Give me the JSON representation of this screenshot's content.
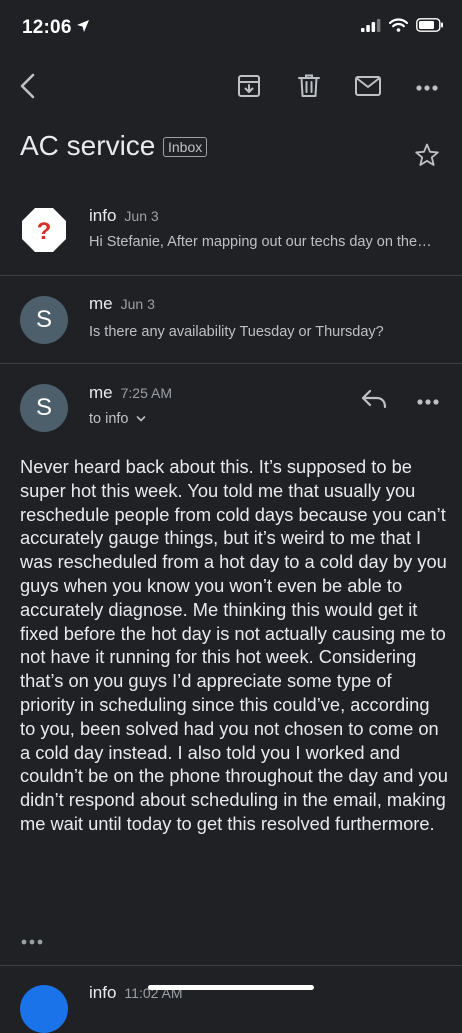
{
  "status_bar": {
    "time": "12:06"
  },
  "icons": [
    "location-arrow-icon",
    "signal-icon",
    "wifi-icon",
    "battery-icon",
    "back-arrow-icon",
    "archive-icon",
    "trash-icon",
    "mail-icon",
    "more-icon",
    "star-icon",
    "reply-icon",
    "warning-question-icon",
    "chevron-down-icon"
  ],
  "email": {
    "subject": "AC service",
    "label": "Inbox"
  },
  "thread": [
    {
      "sender": "info",
      "date": "Jun 3",
      "snippet": "Hi Stefanie, After mapping out our techs day on the route we would like to reschedule"
    },
    {
      "sender": "me",
      "avatar_letter": "S",
      "date": "Jun 3",
      "snippet": "Is there any availability Tuesday or Thursday?"
    },
    {
      "sender": "me",
      "avatar_letter": "S",
      "date": "7:25 AM",
      "to_line": "to info",
      "body": "Never heard back about this. It’s supposed to be super hot this week. You told me that usually you reschedule people from cold days because you can’t accurately gauge things, but it’s weird to me that I was rescheduled from a hot day to a cold day by you guys when you know you won’t even be able to accurately diagnose. Me thinking this would get it fixed before the hot day is not actually causing me to not have it running for this hot week. Considering that’s on you guys I’d appreciate some type of priority in scheduling since this could’ve, according to you, been solved had you not chosen to come on a cold day instead. I also told you I worked and couldn’t be on the phone throughout the day and you didn’t respond about scheduling in the email, making me wait until today to get this resolved furthermore."
    },
    {
      "sender": "info",
      "date": "11:02 AM"
    }
  ],
  "colors": {
    "background": "#202124",
    "avatar": "#4d5f6b",
    "info_avatar": "#1a73e8",
    "warning": "#d93025"
  }
}
